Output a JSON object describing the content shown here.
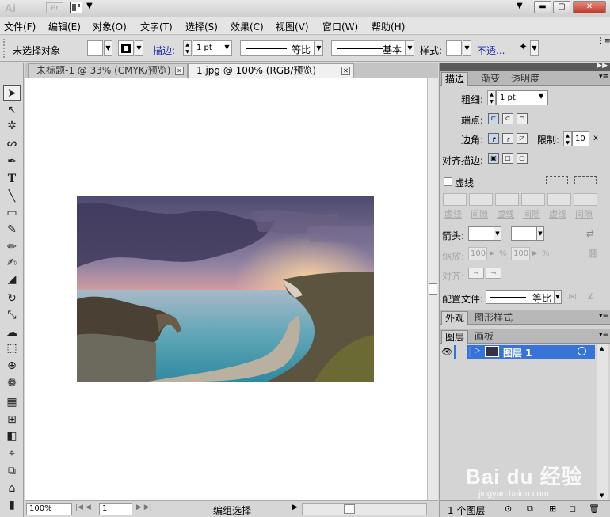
{
  "title_bar": {
    "app_logo": "Ai",
    "bridge_button": "Br",
    "window_buttons": {
      "minimize": "▬",
      "maximize": "▢",
      "close": "✕"
    }
  },
  "menu": [
    "文件(F)",
    "编辑(E)",
    "对象(O)",
    "文字(T)",
    "选择(S)",
    "效果(C)",
    "视图(V)",
    "窗口(W)",
    "帮助(H)"
  ],
  "control_bar": {
    "selection_status": "未选择对象",
    "stroke_link": "描边:",
    "stroke_weight": "1 pt",
    "profile_label": "等比",
    "brush_label": "基本",
    "style_label": "样式:",
    "opacity_link": "不透..."
  },
  "tools": [
    "selection-tool",
    "direct-selection-tool",
    "magic-wand-tool",
    "lasso-tool",
    "pen-tool",
    "type-tool",
    "line-tool",
    "rectangle-tool",
    "paintbrush-tool",
    "pencil-tool",
    "blob-brush-tool",
    "eraser-tool",
    "rotate-tool",
    "scale-tool",
    "warp-tool",
    "free-transform-tool",
    "shape-builder-tool",
    "symbol-sprayer-tool",
    "graph-tool",
    "mesh-tool",
    "gradient-tool",
    "eyedropper-tool",
    "blend-tool",
    "slice-tool",
    "column-graph-tool",
    "artboard-tool"
  ],
  "doc_tabs": [
    {
      "label": "未标题-1 @ 33% (CMYK/预览)",
      "active": false
    },
    {
      "label": "1.jpg @ 100% (RGB/预览)",
      "active": true
    }
  ],
  "status_bar": {
    "zoom": "100%",
    "artboard_number": "1",
    "status_text": "编组选择"
  },
  "stroke_panel": {
    "tabs": [
      "描边",
      "渐变",
      "透明度"
    ],
    "weight_label": "粗细:",
    "weight_value": "1 pt",
    "cap_label": "端点:",
    "corner_label": "边角:",
    "limit_label": "限制:",
    "limit_value": "10",
    "limit_unit": "x",
    "align_label": "对齐描边:",
    "dashed_label": "虚线",
    "dash_labels": [
      "虚线",
      "间隙",
      "虚线",
      "间隙",
      "虚线",
      "间隙"
    ],
    "arrowheads_label": "箭头:",
    "scale_label": "缩放:",
    "scale_values": [
      "100",
      "100"
    ],
    "percent": "%",
    "align_arrows_label": "对齐:",
    "profile_label": "配置文件:",
    "profile_value": "等比"
  },
  "appearance_tabs": [
    "外观",
    "图形样式"
  ],
  "layers_panel": {
    "tabs": [
      "图层",
      "画板"
    ],
    "layers": [
      {
        "name": "图层 1"
      }
    ],
    "footer_count": "1 个图层"
  },
  "watermark": {
    "brand": "Bai du 经验",
    "url": "jingyan.baidu.com"
  },
  "colors": {
    "selection_blue": "#3874d8",
    "link_blue": "#1a2ea8"
  }
}
